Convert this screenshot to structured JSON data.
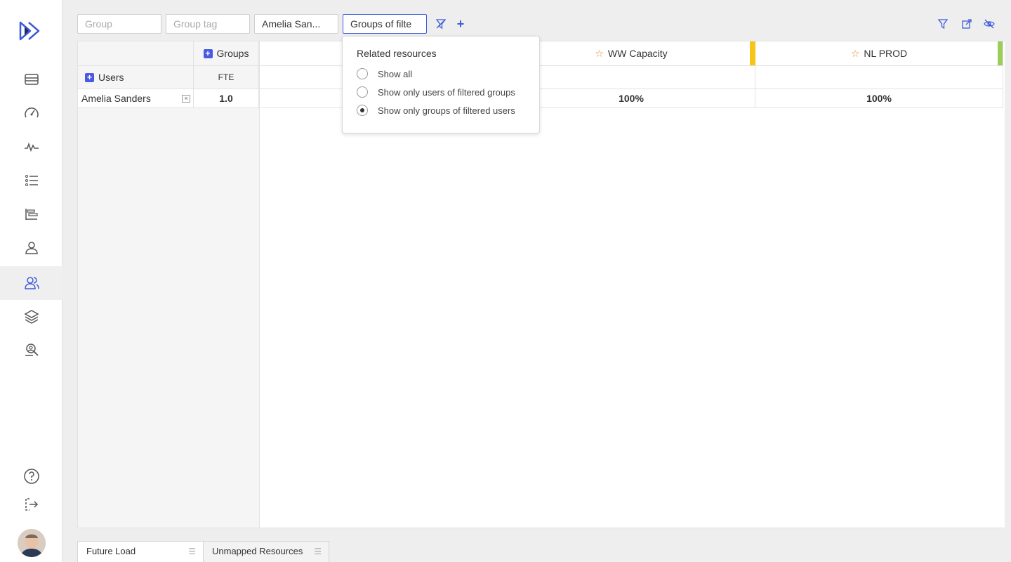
{
  "sidebar": {
    "items": [
      {
        "icon": "list-rows-icon"
      },
      {
        "icon": "speedometer-icon"
      },
      {
        "icon": "activity-icon"
      },
      {
        "icon": "numbered-list-icon"
      },
      {
        "icon": "gantt-icon"
      },
      {
        "icon": "user-icon"
      },
      {
        "icon": "users-icon",
        "active": true
      },
      {
        "icon": "layers-icon"
      },
      {
        "icon": "search-users-icon"
      }
    ],
    "help_icon": "help-icon",
    "logout_icon": "logout-icon"
  },
  "filters": {
    "group_placeholder": "Group",
    "group_tag_placeholder": "Group tag",
    "user_value": "Amelia San...",
    "related_value": "Groups of filte"
  },
  "grid": {
    "groups_header": "Groups",
    "users_header": "Users",
    "fte_header": "FTE",
    "columns": [
      {
        "name": "WW Capacity",
        "strip_color": "#f5c518"
      },
      {
        "name": "NL PROD",
        "strip_color": "#9ccc5a"
      }
    ],
    "rows": [
      {
        "user": "Amelia Sanders",
        "fte": "1.0",
        "values": [
          "100%",
          "100%"
        ]
      }
    ]
  },
  "popup": {
    "title": "Related resources",
    "options": [
      {
        "label": "Show all",
        "checked": false
      },
      {
        "label": "Show only users of filtered groups",
        "checked": false
      },
      {
        "label": "Show only groups of filtered users",
        "checked": true
      }
    ]
  },
  "tabs": [
    {
      "label": "Future Load",
      "active": true
    },
    {
      "label": "Unmapped Resources",
      "active": false
    }
  ],
  "colors": {
    "accent": "#3d5bd9"
  }
}
